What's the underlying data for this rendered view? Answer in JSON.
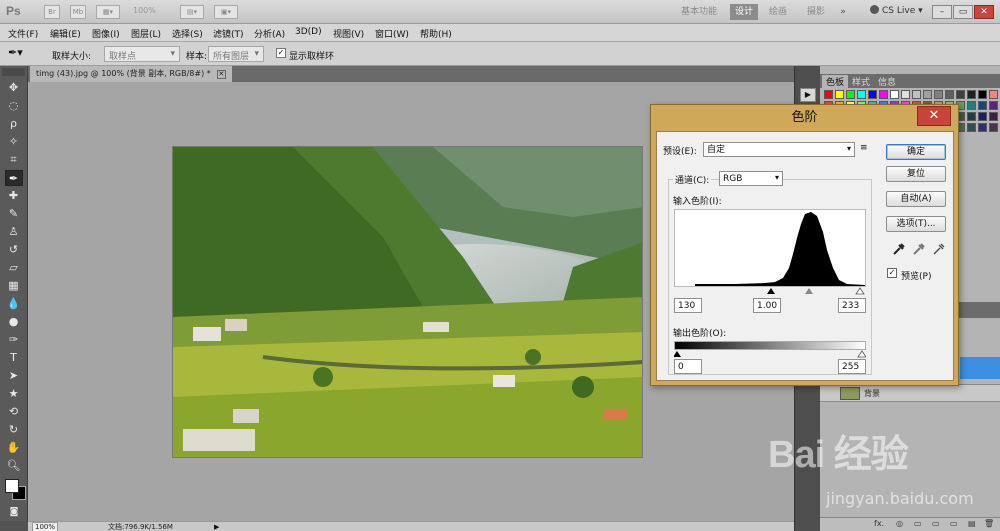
{
  "app": {
    "logo": "Ps",
    "zoom_display": "100%",
    "workspaces": [
      "基本功能",
      "设计",
      "绘画",
      "摄影"
    ],
    "active_workspace": "设计",
    "more": "»",
    "cs_live": "CS Live",
    "window_buttons": [
      "–",
      "▭",
      "✕"
    ]
  },
  "menu": [
    "文件(F)",
    "编辑(E)",
    "图像(I)",
    "图层(L)",
    "选择(S)",
    "滤镜(T)",
    "分析(A)",
    "3D(D)",
    "视图(V)",
    "窗口(W)",
    "帮助(H)"
  ],
  "options": {
    "sample_size_label": "取样大小:",
    "sample_size_value": "取样点",
    "sample_label": "样本:",
    "sample_value": "所有图层",
    "show_ring_label": "显示取样环",
    "show_ring_checked": "✓"
  },
  "document": {
    "tab_title": "timg (43).jpg @ 100% (背景 副本, RGB/8#) *",
    "tab_close": "✕"
  },
  "status": {
    "zoom": "100%",
    "doc_info": "文档:796.9K/1.56M",
    "arrow": "▶"
  },
  "panels": {
    "tabs": [
      "色板",
      "样式",
      "信息"
    ],
    "active_tab": "色板",
    "layer_name_partial": "背景",
    "footer_icons": [
      "fx.",
      "◎",
      "▭",
      "▭",
      "▭",
      "▤",
      "🗑"
    ]
  },
  "levels_dialog": {
    "title": "色阶",
    "close": "✕",
    "preset_label": "预设(E):",
    "preset_value": "自定",
    "channel_label": "通道(C):",
    "channel_value": "RGB",
    "input_levels_label": "输入色阶(I):",
    "input_black": "130",
    "input_gamma": "1.00",
    "input_white": "233",
    "output_levels_label": "输出色阶(O):",
    "output_black": "0",
    "output_white": "255",
    "buttons": {
      "ok": "确定",
      "reset": "复位",
      "auto": "自动(A)",
      "options": "选项(T)..."
    },
    "preview_label": "预览(P)",
    "preview_checked": "✓"
  },
  "watermark": {
    "logo": "Bai 经验",
    "url": "jingyan.baidu.com"
  }
}
